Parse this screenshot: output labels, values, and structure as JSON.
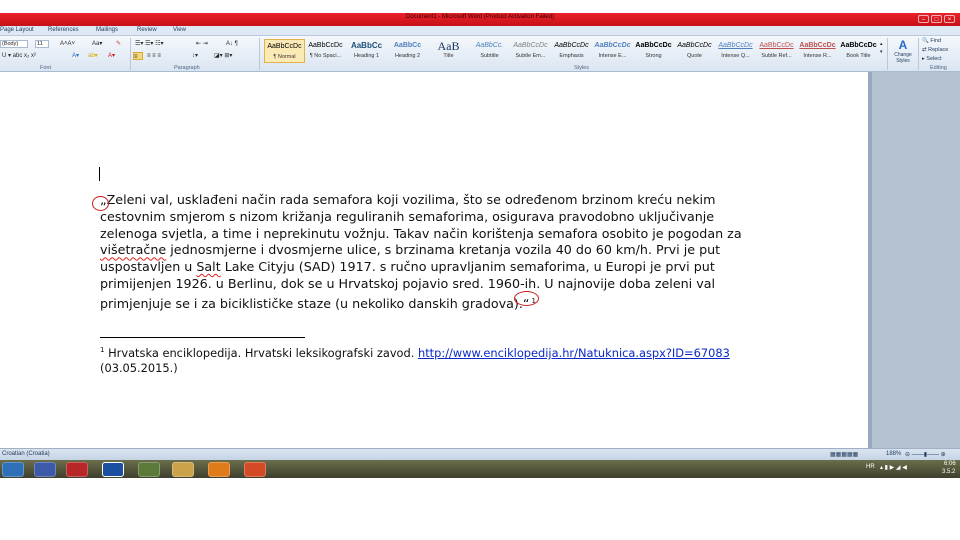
{
  "window": {
    "title": "Document1 - Microsoft Word (Product Activation Failed)"
  },
  "ribbon": {
    "tabs": [
      "Page Layout",
      "References",
      "Mailings",
      "Review",
      "View"
    ],
    "font_name": "(Body)",
    "font_size": "11",
    "group_labels": {
      "font": "Font",
      "paragraph": "Paragraph",
      "styles": "Styles",
      "editing": "Editing"
    },
    "styles": [
      {
        "sample": "AaBbCcDc",
        "name": "¶ Normal"
      },
      {
        "sample": "AaBbCcDc",
        "name": "¶ No Spaci..."
      },
      {
        "sample": "AaBbCc",
        "name": "Heading 1"
      },
      {
        "sample": "AaBbCc",
        "name": "Heading 2"
      },
      {
        "sample": "AaB",
        "name": "Title"
      },
      {
        "sample": "AaBbCc.",
        "name": "Subtitle"
      },
      {
        "sample": "AaBbCcDc",
        "name": "Subtle Em..."
      },
      {
        "sample": "AaBbCcDc",
        "name": "Emphasis"
      },
      {
        "sample": "AaBbCcDc",
        "name": "Intense E..."
      },
      {
        "sample": "AaBbCcDc",
        "name": "Strong"
      },
      {
        "sample": "AaBbCcDc",
        "name": "Quote"
      },
      {
        "sample": "AaBbCcDc",
        "name": "Intense Q..."
      },
      {
        "sample": "AaBbCcDc",
        "name": "Subtle Ref..."
      },
      {
        "sample": "AaBbCcDc",
        "name": "Intense R..."
      },
      {
        "sample": "AaBbCcDc",
        "name": "Book Title"
      }
    ],
    "change_styles": "Change Styles",
    "editing": {
      "find": "Find",
      "replace": "Replace",
      "select": "Select"
    }
  },
  "document": {
    "paragraph_lines": [
      "„Zeleni val, usklađeni način rada semafora koji vozilima, što se određenom brzinom kreću nekim",
      "cestovnim smjerom s nizom križanja reguliranih semaforima, osigurava pravodobno uključivanje",
      "zelenoga svjetla, a time i neprekinutu vožnju. Takav način korištenja semafora osobito je pogodan za",
      "višetračne jednosmjerne i dvosmjerne ulice, s brzinama kretanja vozila 40 do 60 km/h. Prvi je put",
      "uspostavljen u Salt Lake Cityju (SAD) 1917. s ručno upravljanim semaforima, u Europi je prvi put",
      "primijenjen 1926. u Berlinu, dok se u Hrvatskoj pojavio sred. 1960-ih. U najnovije doba zeleni val",
      "primjenjuje se i za biciklističke staze (u nekoliko danskih gradova).“"
    ],
    "footnote_ref": "1",
    "footnote": {
      "number": "1",
      "text": " Hrvatska enciklopedija. Hrvatski leksikografski zavod. ",
      "link": "http://www.enciklopedija.hr/Natuknica.aspx?ID=67083",
      "date": "(03.05.2015.)"
    }
  },
  "statusbar": {
    "language": "Croatian (Croatia)",
    "zoom": "188%"
  },
  "taskbar": {
    "language": "HR",
    "time": "6:06",
    "date": "3.5.2"
  },
  "colors": {
    "title_bar": "#d7161f",
    "annotation_circle": "#cc1b1b",
    "link": "#0a28c8"
  }
}
